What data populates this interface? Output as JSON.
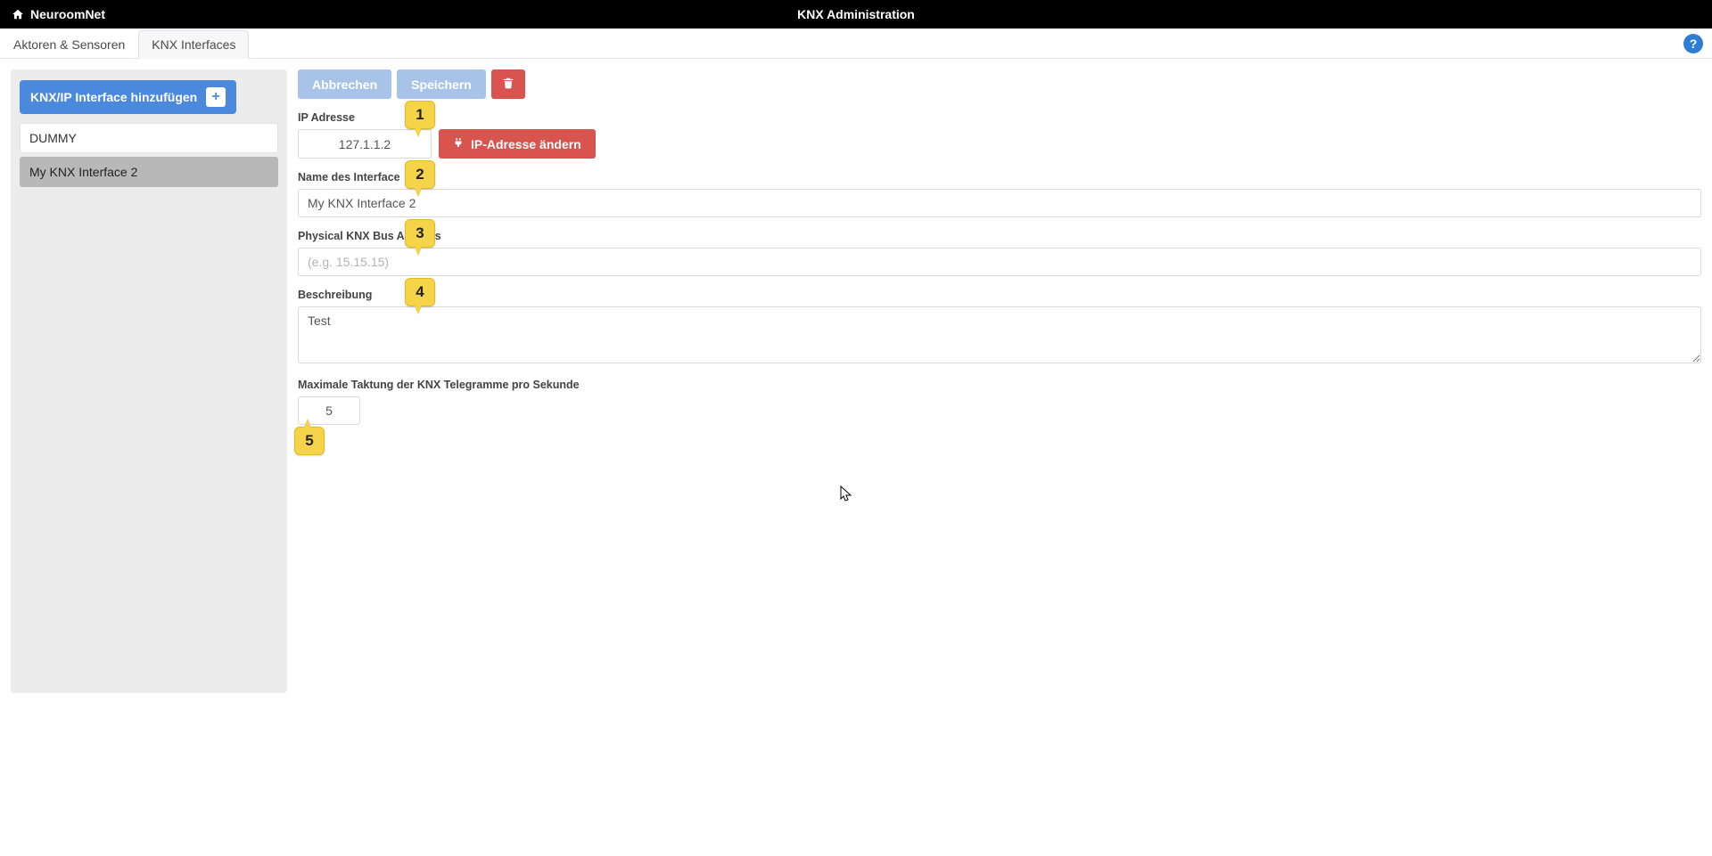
{
  "topbar": {
    "app_name": "NeuroomNet",
    "page_title": "KNX Administration"
  },
  "tabs": {
    "items": [
      {
        "label": "Aktoren & Sensoren"
      },
      {
        "label": "KNX Interfaces"
      }
    ],
    "active_index": 1
  },
  "sidebar": {
    "add_button_label": "KNX/IP Interface hinzufügen",
    "items": [
      {
        "label": "DUMMY"
      },
      {
        "label": "My KNX Interface 2"
      }
    ],
    "selected_index": 1
  },
  "toolbar": {
    "cancel_label": "Abbrechen",
    "save_label": "Speichern"
  },
  "form": {
    "ip": {
      "label": "IP Adresse",
      "value": "127.1.1.2",
      "change_button": "IP-Adresse ändern"
    },
    "name": {
      "label": "Name des Interface",
      "value": "My KNX Interface 2"
    },
    "phys": {
      "label": "Physical KNX Bus Address",
      "placeholder": "(e.g. 15.15.15)",
      "value": ""
    },
    "desc": {
      "label": "Beschreibung",
      "value": "Test"
    },
    "rate": {
      "label": "Maximale Taktung der KNX Telegramme pro Sekunde",
      "value": "5"
    }
  },
  "callouts": {
    "c1": "1",
    "c2": "2",
    "c3": "3",
    "c4": "4",
    "c5": "5"
  },
  "help_icon": "?"
}
